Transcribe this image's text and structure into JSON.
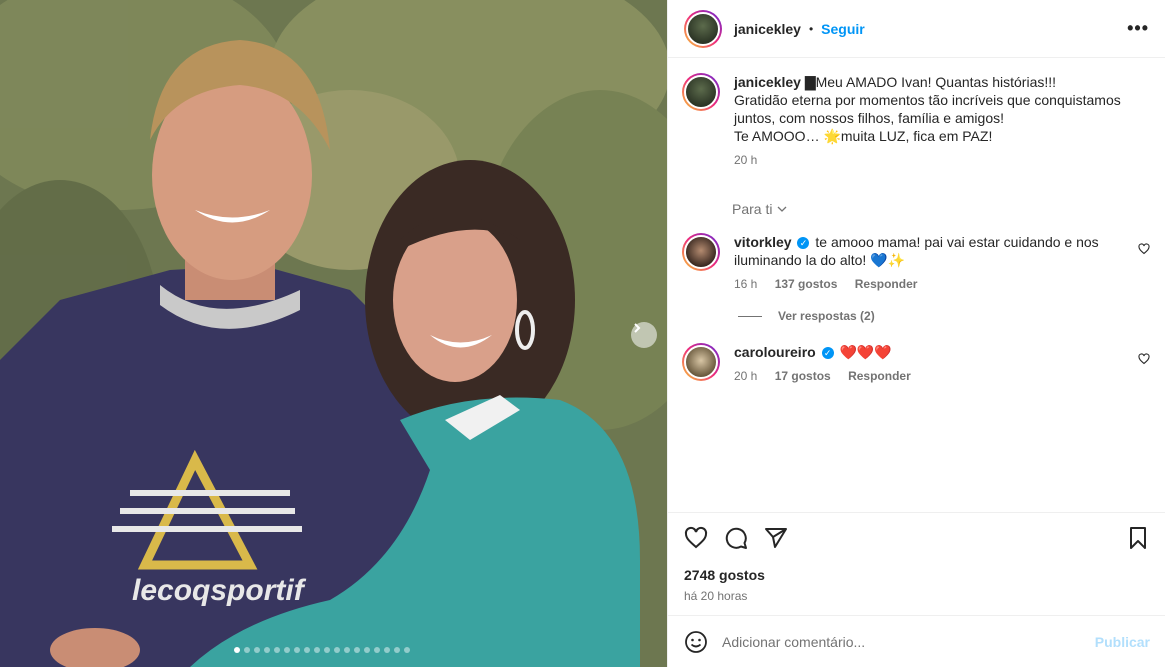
{
  "post": {
    "username": "janicekley",
    "follow_label": "Seguir",
    "separator": "•",
    "more_label": "•••"
  },
  "caption": {
    "username": "janicekley",
    "text_line1": "▇Meu AMADO Ivan! Quantas histórias!!!",
    "text_line2": "Gratidão eterna por momentos tão incríveis que conquistamos juntos, com nossos filhos, família e amigos!",
    "text_line3": "Te AMOOO… 🌟muita LUZ, fica em PAZ!",
    "time": "20 h"
  },
  "filter": {
    "label": "Para ti"
  },
  "comments": [
    {
      "username": "vitorkley",
      "text": "te amooo mama! pai vai estar cuidando e nos iluminando la do alto! 💙✨",
      "time": "16 h",
      "likes": "137 gostos",
      "reply_label": "Responder",
      "view_replies": "Ver respostas (2)"
    },
    {
      "username": "caroloureiro",
      "text": "❤️❤️❤️",
      "time": "20 h",
      "likes": "17 gostos",
      "reply_label": "Responder"
    }
  ],
  "actions": {
    "likes": "2748 gostos",
    "posted": "há 20 horas"
  },
  "add_comment": {
    "placeholder": "Adicionar comentário...",
    "publish_label": "Publicar"
  },
  "carousel": {
    "slides": 18,
    "active": 1
  },
  "colors": {
    "accent": "#0095f6",
    "muted": "#737373",
    "text": "#262626"
  },
  "photo_print_text": "lecoqsportif"
}
